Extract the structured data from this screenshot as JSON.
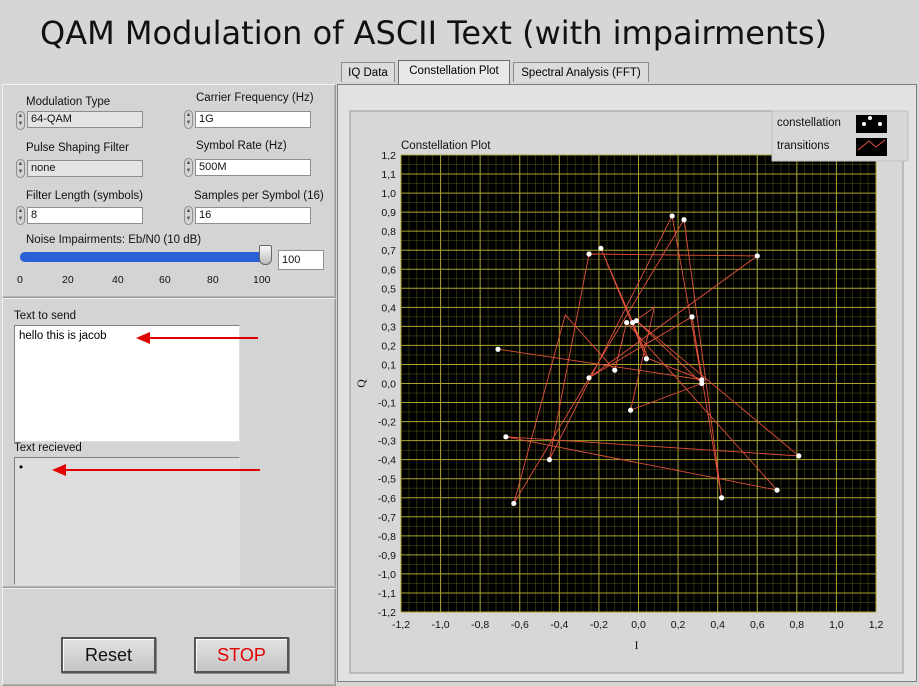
{
  "window": {
    "title": "QAM Modulation of ASCII Text (with impairments)"
  },
  "tabs": [
    {
      "label": "IQ Data"
    },
    {
      "label": "Constellation Plot"
    },
    {
      "label": "Spectral Analysis (FFT)"
    }
  ],
  "controls": {
    "modulation_type": {
      "label": "Modulation Type",
      "value": "64-QAM"
    },
    "carrier_frequency": {
      "label": "Carrier Frequency (Hz)",
      "value": "1G"
    },
    "pulse_shaping": {
      "label": "Pulse Shaping Filter",
      "value": "none"
    },
    "symbol_rate": {
      "label": "Symbol Rate (Hz)",
      "value": "500M"
    },
    "filter_length": {
      "label": "Filter Length (symbols)",
      "value": "8"
    },
    "samples_per_symbol": {
      "label": "Samples per Symbol (16)",
      "value": "16"
    },
    "noise": {
      "label": "Noise Impairments: Eb/N0 (10 dB)",
      "value": "100",
      "slider_fraction": 1.0,
      "scale": [
        "0",
        "20",
        "40",
        "60",
        "80",
        "100"
      ]
    }
  },
  "text_to_send": {
    "label": "Text to send",
    "value": "hello this is jacob"
  },
  "text_received": {
    "label": "Text recieved",
    "value": "•"
  },
  "buttons": {
    "reset": "Reset",
    "stop": "STOP"
  },
  "colors": {
    "plot_bg": "#000000",
    "grid_major": "#a7a32d",
    "grid_minor": "#4a4a16",
    "transitions": "#e2503d",
    "stop_text": "#e00000",
    "slider": "#2a5fd8",
    "annotation_arrow": "#e00000"
  },
  "chart_data": {
    "type": "scatter",
    "title": "Constellation Plot",
    "xlabel": "I",
    "ylabel": "Q",
    "xlim": [
      -1.2,
      1.2
    ],
    "ylim": [
      -1.2,
      1.2
    ],
    "xticks": [
      "-1,2",
      "-1,0",
      "-0,8",
      "-0,6",
      "-0,4",
      "-0,2",
      "0,0",
      "0,2",
      "0,4",
      "0,6",
      "0,8",
      "1,0",
      "1,2"
    ],
    "yticks": [
      "1,2",
      "1,1",
      "1,0",
      "0,9",
      "0,8",
      "0,7",
      "0,6",
      "0,5",
      "0,4",
      "0,3",
      "0,2",
      "0,1",
      "0,0",
      "-0,1",
      "-0,2",
      "-0,3",
      "-0,4",
      "-0,5",
      "-0,6",
      "-0,7",
      "-0,8",
      "-0,9",
      "-1,0",
      "-1,1",
      "-1,2"
    ],
    "grid": true,
    "legend": {
      "placement": "top-right",
      "entries": [
        "constellation",
        "transitions"
      ]
    },
    "series": [
      {
        "name": "constellation",
        "points": [
          [
            -0.71,
            0.18
          ],
          [
            -0.25,
            0.03
          ],
          [
            -0.04,
            -0.14
          ],
          [
            0.04,
            0.13
          ],
          [
            0.32,
            0.02
          ],
          [
            -0.63,
            -0.63
          ],
          [
            -0.45,
            -0.4
          ],
          [
            -0.12,
            0.07
          ],
          [
            0.42,
            -0.6
          ],
          [
            0.7,
            -0.56
          ],
          [
            0.81,
            -0.38
          ],
          [
            -0.67,
            -0.28
          ],
          [
            0.6,
            0.67
          ],
          [
            -0.25,
            0.68
          ],
          [
            0.17,
            0.88
          ],
          [
            0.23,
            0.86
          ],
          [
            0.27,
            0.35
          ],
          [
            -0.19,
            0.71
          ],
          [
            -0.06,
            0.32
          ],
          [
            -0.03,
            0.32
          ],
          [
            -0.01,
            0.33
          ],
          [
            0.32,
            0.0
          ]
        ]
      },
      {
        "name": "transitions",
        "points": [
          [
            -0.71,
            0.18
          ],
          [
            0.32,
            0.02
          ],
          [
            0.17,
            0.88
          ],
          [
            -0.45,
            -0.4
          ],
          [
            -0.25,
            0.68
          ],
          [
            0.6,
            0.67
          ],
          [
            -0.25,
            0.03
          ],
          [
            0.27,
            0.35
          ],
          [
            0.42,
            -0.6
          ],
          [
            0.23,
            0.86
          ],
          [
            -0.63,
            -0.63
          ],
          [
            -0.37,
            0.36
          ],
          [
            -0.12,
            0.07
          ],
          [
            -0.06,
            0.32
          ],
          [
            0.7,
            -0.56
          ],
          [
            -0.67,
            -0.28
          ],
          [
            0.81,
            -0.38
          ],
          [
            -0.01,
            0.33
          ],
          [
            0.32,
            0.0
          ],
          [
            -0.04,
            -0.14
          ],
          [
            0.08,
            0.4
          ],
          [
            -0.03,
            0.32
          ],
          [
            0.04,
            0.13
          ],
          [
            -0.19,
            0.71
          ],
          [
            0.05,
            0.13
          ],
          [
            0.32,
            0.02
          ]
        ]
      }
    ]
  }
}
